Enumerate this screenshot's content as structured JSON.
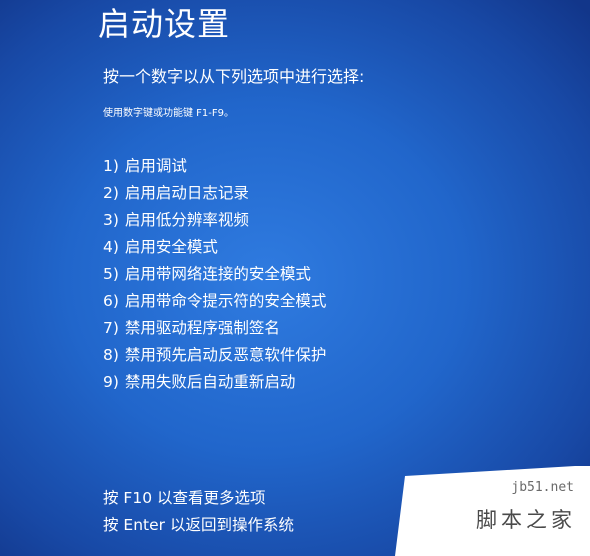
{
  "title": "启动设置",
  "instruction": "按一个数字以从下列选项中进行选择:",
  "hint": "使用数字键或功能键 F1-F9。",
  "options": [
    {
      "number": "1)",
      "label": "启用调试"
    },
    {
      "number": "2)",
      "label": "启用启动日志记录"
    },
    {
      "number": "3)",
      "label": "启用低分辨率视频"
    },
    {
      "number": "4)",
      "label": "启用安全模式"
    },
    {
      "number": "5)",
      "label": "启用带网络连接的安全模式"
    },
    {
      "number": "6)",
      "label": "启用带命令提示符的安全模式"
    },
    {
      "number": "7)",
      "label": "禁用驱动程序强制签名"
    },
    {
      "number": "8)",
      "label": "禁用预先启动反恶意软件保护"
    },
    {
      "number": "9)",
      "label": "禁用失败后自动重新启动"
    }
  ],
  "footer": {
    "more_options": "按 F10 以查看更多选项",
    "return_os": "按 Enter 以返回到操作系统"
  },
  "watermark": {
    "url": "jb51.net",
    "name": "脚本之家"
  },
  "colors": {
    "background": "#2166cb",
    "text": "#ffffff"
  }
}
